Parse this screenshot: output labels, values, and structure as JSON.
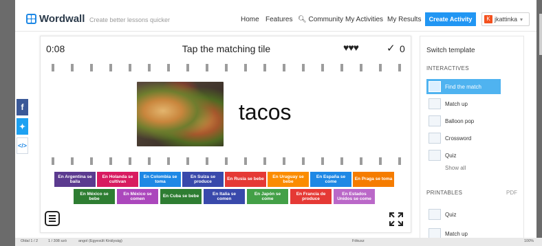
{
  "header": {
    "logo": "Wordwall",
    "tagline": "Create better lessons quicker",
    "nav": [
      "Home",
      "Features",
      "Community",
      "My Activities",
      "My Results"
    ],
    "create_button": "Create Activity",
    "user": {
      "initial": "K",
      "name": "jkattinka",
      "caret": "▾"
    }
  },
  "activity": {
    "timer": "0:08",
    "prompt": "Tap the matching tile",
    "hearts": "♥♥♥",
    "check": "✓",
    "score": "0",
    "word": "tacos",
    "image_alt": "tacos-photo",
    "tiles_row1": [
      {
        "text": "En Argentina se baila",
        "color": "#5b3a8f"
      },
      {
        "text": "En Holanda se cultivan",
        "color": "#d81b60"
      },
      {
        "text": "En Colombia se toma",
        "color": "#1e88e5"
      },
      {
        "text": "En Suiza se produce",
        "color": "#3949ab"
      },
      {
        "text": "En Rusia se bebe",
        "color": "#e53935"
      },
      {
        "text": "En Uruguay se bebe",
        "color": "#fb8c00"
      },
      {
        "text": "En España se come",
        "color": "#1e88e5"
      },
      {
        "text": "En Praga se toma",
        "color": "#f57c00"
      }
    ],
    "tiles_row2": [
      {
        "text": "En México se bebe",
        "color": "#2e7d32"
      },
      {
        "text": "En México se comen",
        "color": "#ab47bc"
      },
      {
        "text": "En Cuba se bebe",
        "color": "#2e7d32"
      },
      {
        "text": "En Italia se comen",
        "color": "#3949ab"
      },
      {
        "text": "En Japón se come",
        "color": "#43a047"
      },
      {
        "text": "En Francia de produce",
        "color": "#e53935"
      },
      {
        "text": "En Estados Unidos se come",
        "color": "#ba68c8"
      }
    ]
  },
  "sidebar": {
    "title": "Switch template",
    "interactives_heading": "INTERACTIVES",
    "interactives": [
      "Find the match",
      "Match up",
      "Balloon pop",
      "Crossword",
      "Quiz"
    ],
    "show_all": "Show all",
    "printables_heading": "PRINTABLES",
    "pdf": "PDF",
    "printables": [
      "Quiz",
      "Match up"
    ]
  },
  "social": [
    {
      "icon": "facebook-icon",
      "glyph": "f",
      "color": "#3b5998"
    },
    {
      "icon": "twitter-icon",
      "glyph": "🐦",
      "color": "#1da1f2"
    },
    {
      "icon": "embed-icon",
      "glyph": "</>",
      "color": "#ffffff"
    }
  ],
  "statusbar": {
    "page": "Oldal 1 / 2",
    "words": "1 / 308 szó",
    "language": "angol (Egyesült Királyság)",
    "focus": "Fókusz",
    "zoom": "100%"
  }
}
